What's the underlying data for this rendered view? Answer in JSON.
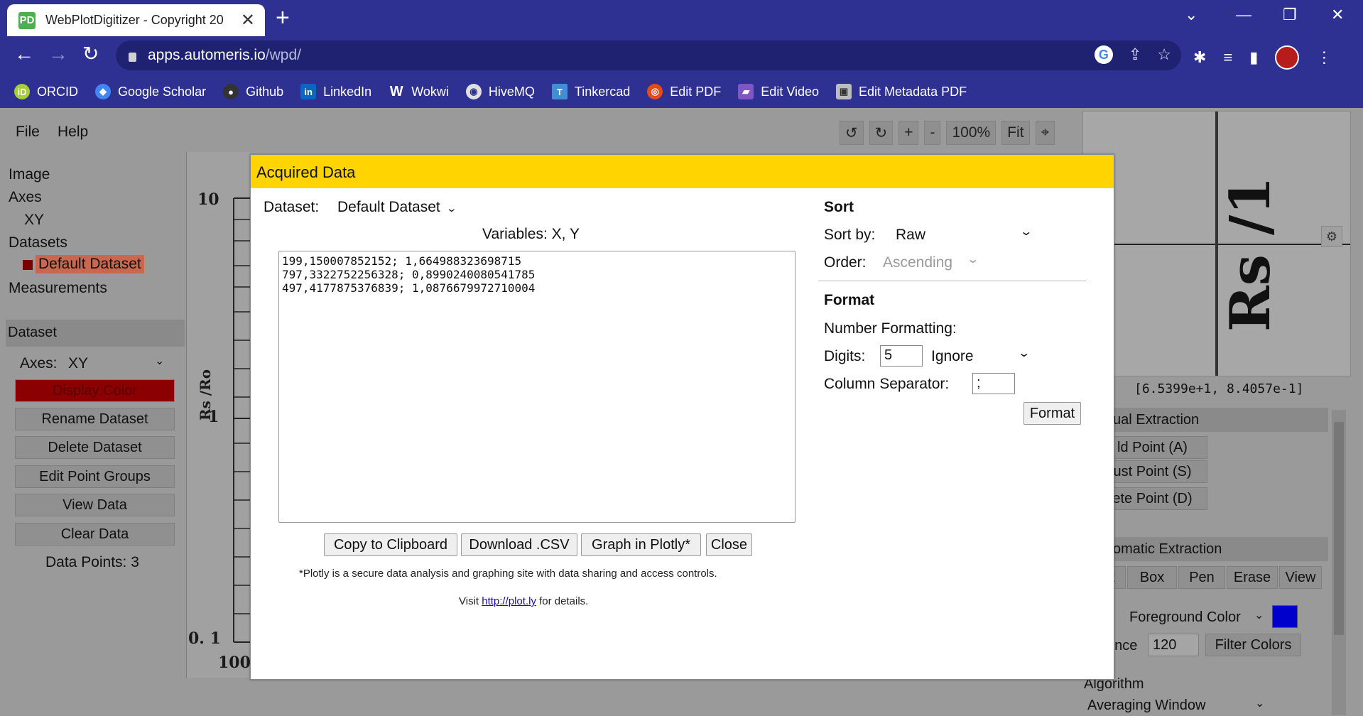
{
  "browser": {
    "tab_title": "WebPlotDigitizer - Copyright 20",
    "tab_favicon_text": "PD",
    "url_host": "apps.automeris.io",
    "url_path": "/wpd/",
    "bookmarks": [
      {
        "label": "ORCID",
        "icon": "orcid-icon",
        "color": "#a6ce39",
        "glyph": "iD"
      },
      {
        "label": "Google Scholar",
        "icon": "scholar-icon",
        "color": "#4285f4",
        "glyph": "◆"
      },
      {
        "label": "Github",
        "icon": "github-icon",
        "color": "#333333",
        "glyph": "●"
      },
      {
        "label": "LinkedIn",
        "icon": "linkedin-icon",
        "color": "#0a66c2",
        "glyph": "in"
      },
      {
        "label": "Wokwi",
        "icon": "wokwi-icon",
        "color": "#2e3192",
        "glyph": "W"
      },
      {
        "label": "HiveMQ",
        "icon": "hivemq-icon",
        "color": "#e0e0e0",
        "glyph": "◉"
      },
      {
        "label": "Tinkercad",
        "icon": "tinkercad-icon",
        "color": "#3f8fd2",
        "glyph": "T"
      },
      {
        "label": "Edit PDF",
        "icon": "editpdf-icon",
        "color": "#e64a19",
        "glyph": "◎"
      },
      {
        "label": "Edit Video",
        "icon": "editvideo-icon",
        "color": "#7e57c2",
        "glyph": "▰"
      },
      {
        "label": "Edit Metadata PDF",
        "icon": "metadata-icon",
        "color": "#bdbdbd",
        "glyph": "▣"
      }
    ]
  },
  "app": {
    "menu": {
      "file": "File",
      "help": "Help"
    },
    "zoom": {
      "rotate_left": "↺",
      "rotate_right": "↻",
      "zoom_in": "+",
      "zoom_out": "-",
      "zoom_level": "100%",
      "fit": "Fit",
      "crosshair": "⌖"
    },
    "tree": {
      "image": "Image",
      "axes": "Axes",
      "xy": "XY",
      "datasets": "Datasets",
      "default_dataset": "Default Dataset",
      "measurements": "Measurements"
    },
    "dataset_panel": {
      "header": "Dataset",
      "axes_label": "Axes:",
      "axes_value": "XY",
      "display_color": "Display Color",
      "rename": "Rename Dataset",
      "delete": "Delete Dataset",
      "edit_groups": "Edit Point Groups",
      "view_data": "View Data",
      "clear_data": "Clear Data",
      "data_points": "Data Points: 3"
    },
    "plot": {
      "y_top": "10",
      "y_mid": "1",
      "y_bottom": "0. 1",
      "y_label": "Rs /Ro",
      "x_first": "100"
    },
    "right_panel": {
      "magnifier_glyph": "Rs /1",
      "coordinates": "[6.5399e+1, 8.4057e-1]",
      "manual_head": "ual Extraction",
      "add_point": "ld Point (A)",
      "adjust_point": "ust Point (S)",
      "delete_point": "ete Point (D)",
      "auto_head": "omatic Extraction",
      "auto_tools": [
        "k",
        "Box",
        "Pen",
        "Erase",
        "View"
      ],
      "fg_prefix": "r",
      "fg_label": "Foreground Color",
      "fg_color": "#0000cc",
      "distance_label": "ance",
      "distance_value": "120",
      "filter_colors": "Filter Colors",
      "algorithm_label": "Algorithm",
      "algorithm_value": "Averaging Window"
    }
  },
  "modal": {
    "title": "Acquired Data",
    "dataset_label": "Dataset:",
    "dataset_value": "Default Dataset",
    "variables": "Variables: X, Y",
    "data_text": "199,150007852152; 1,664988323698715\n797,3322752256328; 0,8990240080541785\n497,4177875376839; 1,0876679972710004",
    "sort_head": "Sort",
    "sort_by_label": "Sort by:",
    "sort_by_value": "Raw",
    "order_label": "Order:",
    "order_value": "Ascending",
    "format_head": "Format",
    "number_formatting": "Number Formatting:",
    "digits_label": "Digits:",
    "digits_value": "5",
    "digits_mode": "Ignore",
    "column_sep_label": "Column Separator:",
    "column_sep_value": ";",
    "format_button": "Format",
    "copy_button": "Copy to Clipboard",
    "download_button": "Download .CSV",
    "plotly_button": "Graph in Plotly*",
    "close_button": "Close",
    "footnote": "*Plotly is a secure data analysis and graphing site with data sharing and access controls.",
    "visit_prefix": "Visit ",
    "visit_link": "http://plot.ly",
    "visit_suffix": " for details."
  }
}
